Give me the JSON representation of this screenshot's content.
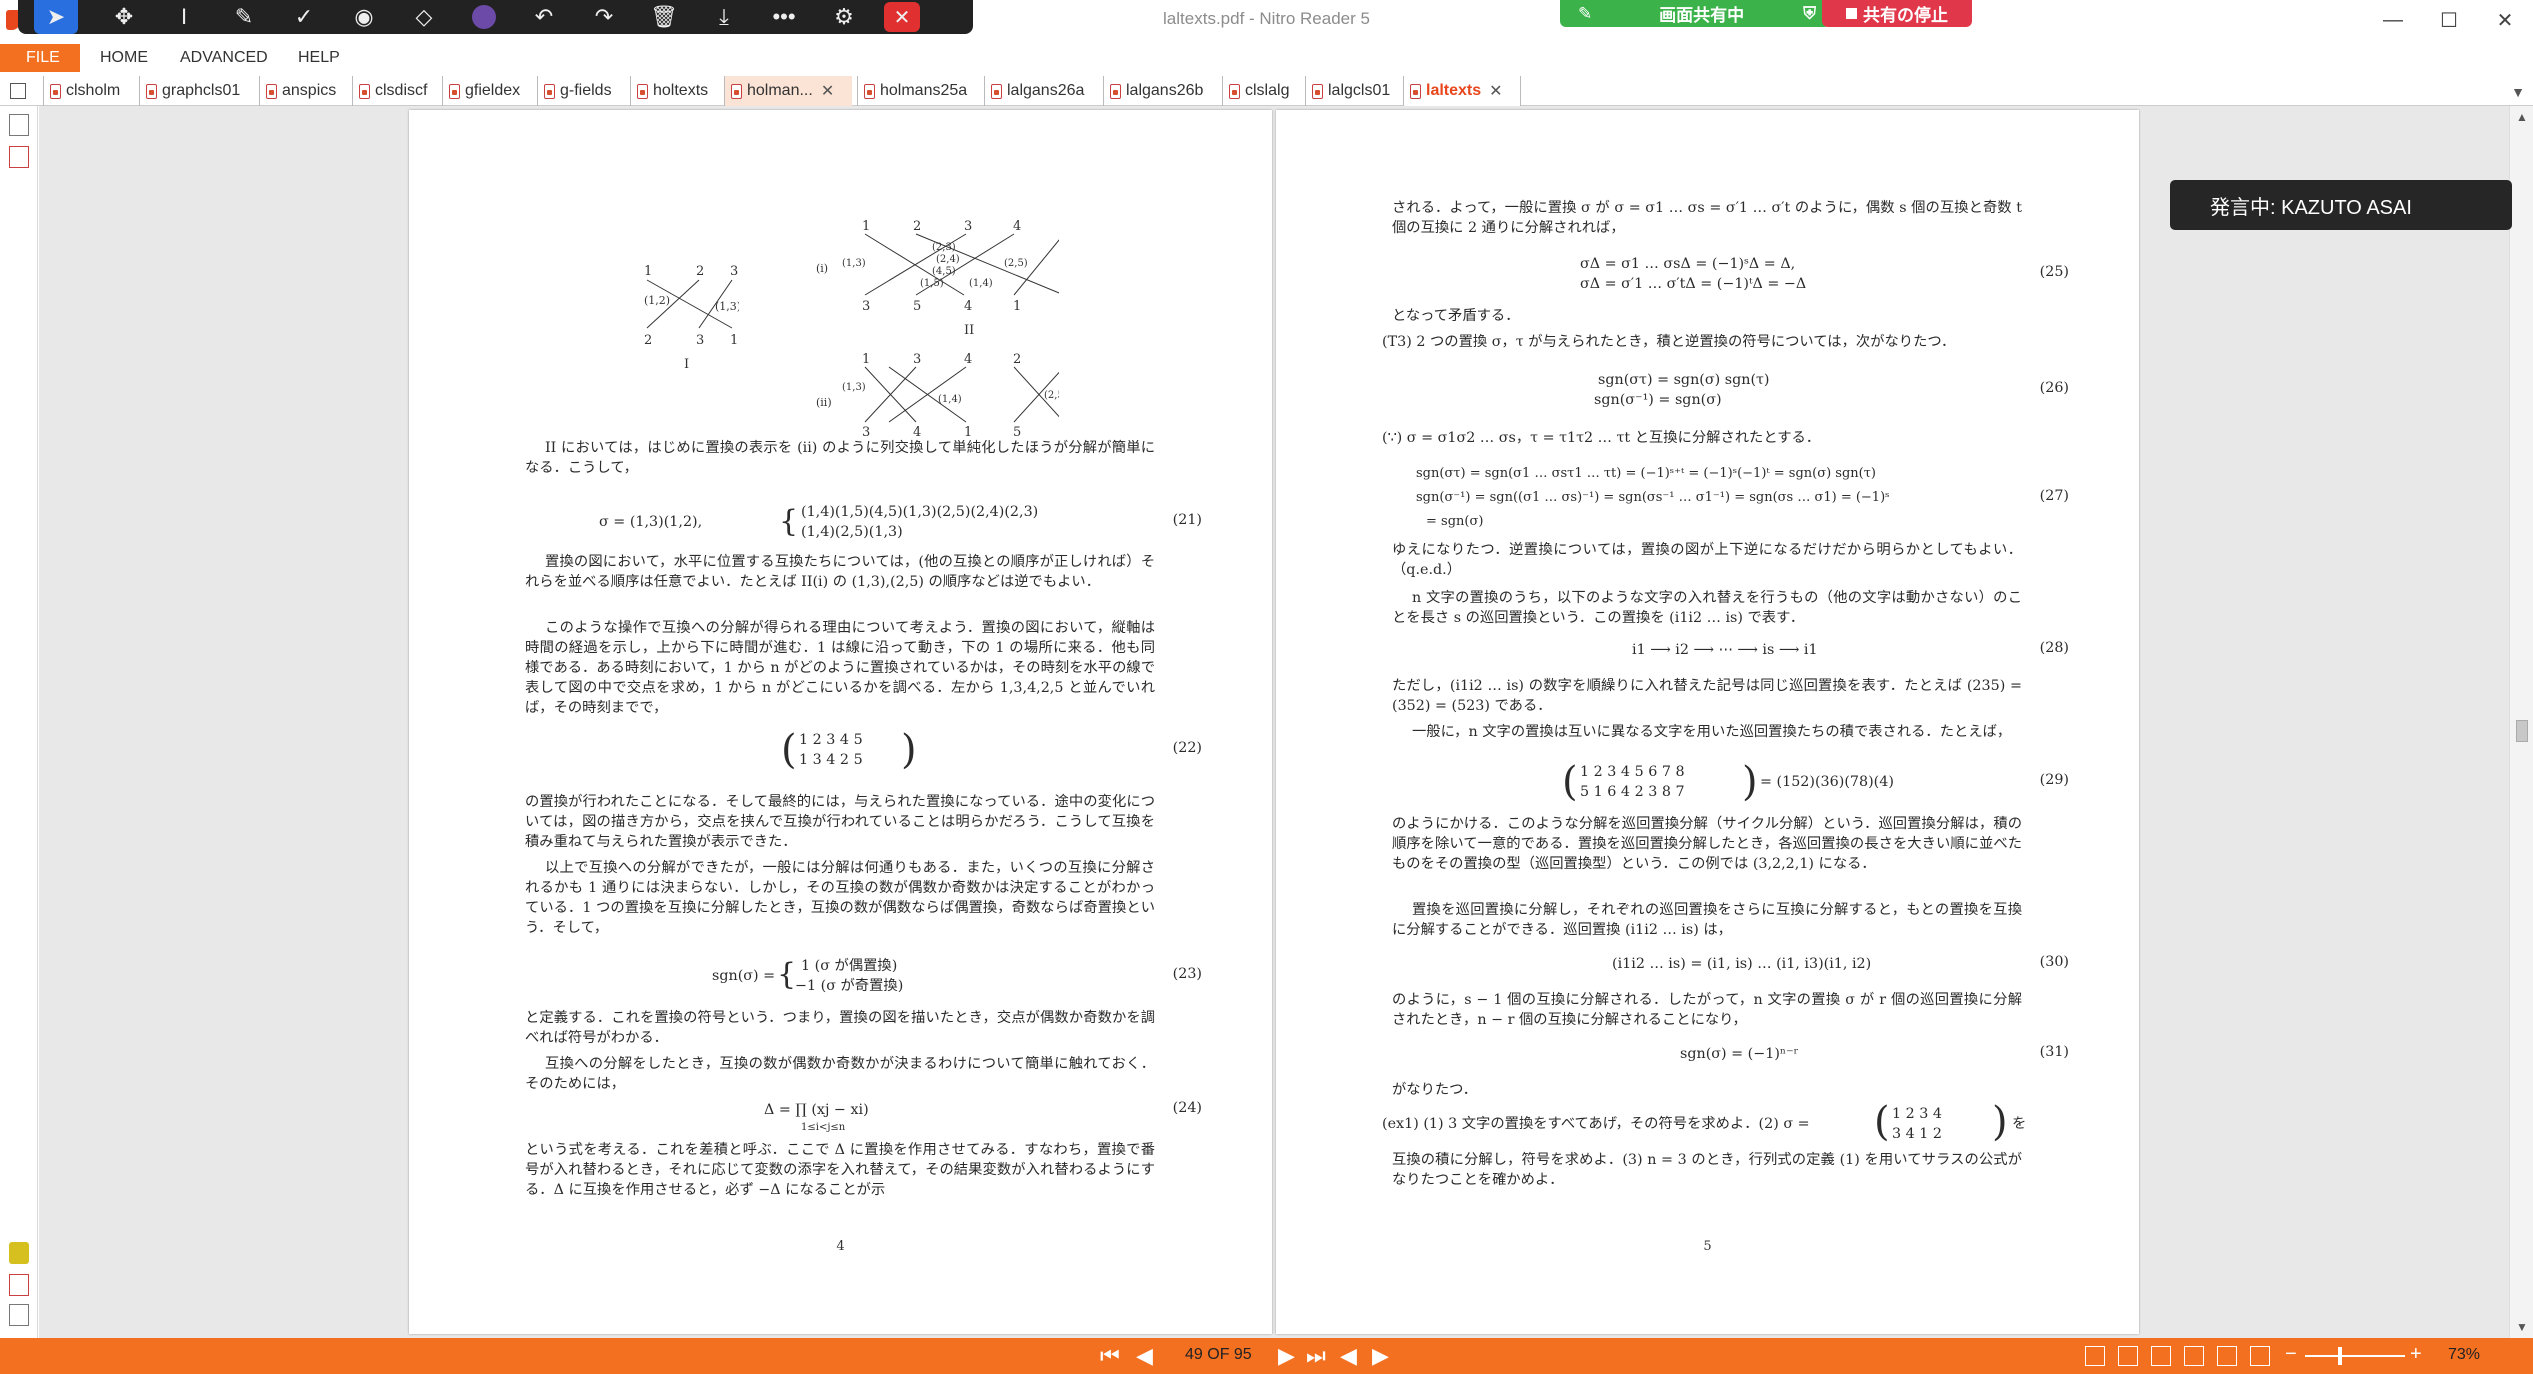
{
  "window": {
    "title": "laltexts.pdf - Nitro Reader 5"
  },
  "draw_toolbar": {
    "icons": [
      "pointer-tool",
      "move-tool",
      "text-cursor-tool",
      "pen-tool",
      "check-tool",
      "stamp-tool",
      "eraser-tool",
      "color-swatch",
      "undo",
      "redo",
      "delete",
      "download",
      "more",
      "user-settings",
      "close"
    ]
  },
  "share": {
    "label": "画面共有中",
    "stop_label": "共有の停止"
  },
  "menu": {
    "file": "FILE",
    "items": [
      "HOME",
      "ADVANCED",
      "HELP"
    ]
  },
  "tabs": [
    {
      "label": "clsholm"
    },
    {
      "label": "graphcls01"
    },
    {
      "label": "anspics"
    },
    {
      "label": "clsdiscf"
    },
    {
      "label": "gfieldex"
    },
    {
      "label": "g-fields"
    },
    {
      "label": "holtexts"
    },
    {
      "label": "holman..."
    },
    {
      "label": "holmans25a"
    },
    {
      "label": "lalgans26a"
    },
    {
      "label": "lalgans26b"
    },
    {
      "label": "clslalg"
    },
    {
      "label": "lalgcls01"
    },
    {
      "label": "laltexts"
    }
  ],
  "speaker": "発言中: KAZUTO ASAI",
  "status": {
    "page_count": "49 OF 95",
    "zoom": "73%"
  },
  "page4": {
    "fig_labels": {
      "I": "I",
      "II": "II",
      "i": "(i)",
      "ii": "(ii)"
    },
    "p1": "II においては，はじめに置換の表示を (ii) のように列交換して単純化したほうが分解が簡単になる．こうして，",
    "eq21": "σ = (1,3)(1,2),      τ = { (1,4)(1,5)(4,5)(1,3)(2,5)(2,4)(2,3) ; (1,4)(2,5)(1,3)",
    "eq21_a": "σ = (1,3)(1,2),",
    "eq21_b1": "(1,4)(1,5)(4,5)(1,3)(2,5)(2,4)(2,3)",
    "eq21_b2": "(1,4)(2,5)(1,3)",
    "n21": "(21)",
    "p2": "置換の図において，水平に位置する互換たちについては，(他の互換との順序が正しければ）それらを並べる順序は任意でよい．たとえば II(i) の (1,3),(2,5) の順序などは逆でもよい．",
    "p3": "このような操作で互換への分解が得られる理由について考えよう．置換の図において，縦軸は時間の経過を示し，上から下に時間が進む．1 は線に沿って動き，下の 1 の場所に来る．他も同様である．ある時刻において，1 から n がどのように置換されているかは，その時刻を水平の線で表して図の中で交点を求め，1 から n がどこにいるかを調べる．左から 1,3,4,2,5 と並んでいれば，その時刻までで，",
    "eq22_r1": "1  2  3  4  5",
    "eq22_r2": "1  3  4  2  5",
    "n22": "(22)",
    "p4": "の置換が行われたことになる．そして最終的には，与えられた置換になっている．途中の変化については，図の描き方から，交点を挟んで互換が行われていることは明らかだろう．こうして互換を積み重ねて与えられた置換が表示できた．",
    "p5": "以上で互換への分解ができたが，一般には分解は何通りもある．また，いくつの互換に分解されるかも 1 通りには決まらない．しかし，その互換の数が偶数か奇数かは決定することがわかっている．1 つの置換を互換に分解したとき，互換の数が偶数ならば偶置換，奇数ならば奇置換という．そして，",
    "eq23_l": "sgn(σ) =",
    "eq23_r1": "1      (σ が偶置換)",
    "eq23_r2": "−1     (σ が奇置換)",
    "n23": "(23)",
    "p6": "と定義する．これを置換の符号という．つまり，置換の図を描いたとき，交点が偶数か奇数かを調べれば符号がわかる．",
    "p7": "互換への分解をしたとき，互換の数が偶数か奇数かが決まるわけについて簡単に触れておく．そのためには，",
    "eq24": "Δ =  ∏  (xj − xi)",
    "eq24_sub": "1≤i<j≤n",
    "n24": "(24)",
    "p8": "という式を考える．これを差積と呼ぶ．ここで Δ に置換を作用させてみる．すなわち，置換で番号が入れ替わるとき，それに応じて変数の添字を入れ替えて，その結果変数が入れ替わるようにする．Δ に互換を作用させると，必ず −Δ になることが示",
    "pagenum": "4"
  },
  "page5": {
    "p1": "される．よって，一般に置換 σ が σ = σ1 … σs = σ′1 … σ′t のように，偶数 s 個の互換と奇数 t 個の互換に 2 通りに分解されれば，",
    "eq25_1": "σΔ = σ1 … σsΔ = (−1)ˢΔ = Δ,",
    "eq25_2": "σΔ = σ′1 … σ′tΔ = (−1)ᵗΔ = −Δ",
    "n25": "(25)",
    "p2": "となって矛盾する．",
    "p3": "(T3) 2 つの置換 σ，τ が与えられたとき，積と逆置換の符号については，次がなりたつ．",
    "eq26_1": "sgn(στ) = sgn(σ) sgn(τ)",
    "eq26_2": "sgn(σ⁻¹) = sgn(σ)",
    "n26": "(26)",
    "p4": "(∵) σ = σ1σ2 … σs，τ = τ1τ2 … τt と互換に分解されたとする．",
    "eq27_1": "sgn(στ) = sgn(σ1 … σsτ1 … τt) = (−1)ˢ⁺ᵗ = (−1)ˢ(−1)ᵗ = sgn(σ) sgn(τ)",
    "eq27_2": "sgn(σ⁻¹) = sgn((σ1 … σs)⁻¹) = sgn(σs⁻¹ … σ1⁻¹) = sgn(σs … σ1) = (−1)ˢ",
    "eq27_3": "= sgn(σ)",
    "n27": "(27)",
    "p5": "ゆえになりたつ．逆置換については，置換の図が上下逆になるだけだから明らかとしてもよい．（q.e.d.）",
    "p6": "n 文字の置換のうち，以下のような文字の入れ替えを行うもの（他の文字は動かさない）のことを長さ s の巡回置換という．この置換を (i1i2 … is) で表す．",
    "eq28": "i1 ⟶ i2 ⟶ ⋯ ⟶ is ⟶ i1",
    "n28": "(28)",
    "p7": "ただし，(i1i2 … is) の数字を順繰りに入れ替えた記号は同じ巡回置換を表す．たとえば (235) = (352) = (523) である．",
    "p8": "一般に，n 文字の置換は互いに異なる文字を用いた巡回置換たちの積で表される．たとえば，",
    "eq29_r1": "1  2  3  4  5  6  7  8",
    "eq29_r2": "5  1  6  4  2  3  8  7",
    "eq29_rhs": "= (152)(36)(78)(4)",
    "n29": "(29)",
    "p9": "のようにかける．このような分解を巡回置換分解（サイクル分解）という．巡回置換分解は，積の順序を除いて一意的である．置換を巡回置換分解したとき，各巡回置換の長さを大きい順に並べたものをその置換の型（巡回置換型）という．この例では (3,2,2,1) になる．",
    "p10": "置換を巡回置換に分解し，それぞれの巡回置換をさらに互換に分解すると，もとの置換を互換に分解することができる．巡回置換 (i1i2 … is) は，",
    "eq30": "(i1i2 … is) = (i1, is) … (i1, i3)(i1, i2)",
    "n30": "(30)",
    "p11": "のように，s − 1 個の互換に分解される．したがって，n 文字の置換 σ が r 個の巡回置換に分解されたとき，n − r 個の互換に分解されることになり，",
    "eq31": "sgn(σ) = (−1)ⁿ⁻ʳ",
    "n31": "(31)",
    "p12": "がなりたつ．",
    "p13a": "(ex1) (1) 3 文字の置換をすべてあげ，その符号を求めよ．(2) σ =",
    "ex_r1": "1  2  3  4",
    "ex_r2": "3  4  1  2",
    "p13b": "を",
    "p14": "互換の積に分解し，符号を求めよ．(3) n = 3 のとき，行列式の定義 (1) を用いてサラスの公式がなりたつことを確かめよ．",
    "pagenum": "5"
  }
}
